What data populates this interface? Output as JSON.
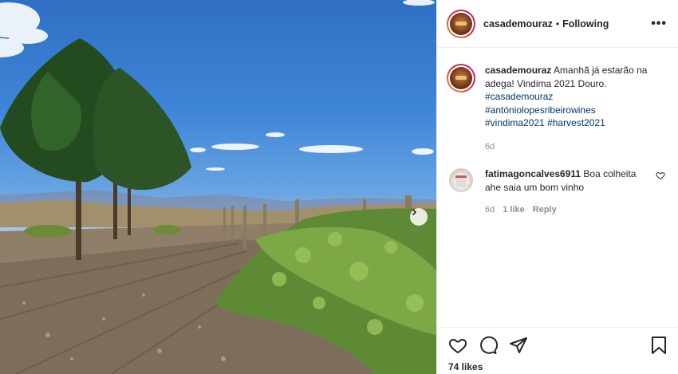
{
  "post": {
    "username": "casademouraz",
    "separator": "•",
    "follow_status": "Following",
    "more_label": "•••",
    "caption": {
      "username": "casademouraz",
      "text": "Amanhã já estarão na adega! Vindima 2021 Douro.",
      "hashtags": [
        "#casademouraz",
        "#antóniolopesribeirowines",
        "#vindima2021",
        "#harvest2021"
      ],
      "time": "6d"
    },
    "comments": [
      {
        "username": "fatimagoncalves6911",
        "text": "Boa colheita ahe saia um bom vinho",
        "time": "6d",
        "likes": "1 like",
        "reply_label": "Reply"
      }
    ],
    "likes_count": "74 likes"
  },
  "icons": {
    "like": "heart-icon",
    "comment": "comment-icon",
    "share": "paper-plane-icon",
    "save": "bookmark-icon",
    "next": "chevron-right-icon",
    "more": "more-horizontal-icon"
  },
  "colors": {
    "hashtag": "#00376b",
    "muted": "#8e8e8e",
    "text": "#262626"
  }
}
